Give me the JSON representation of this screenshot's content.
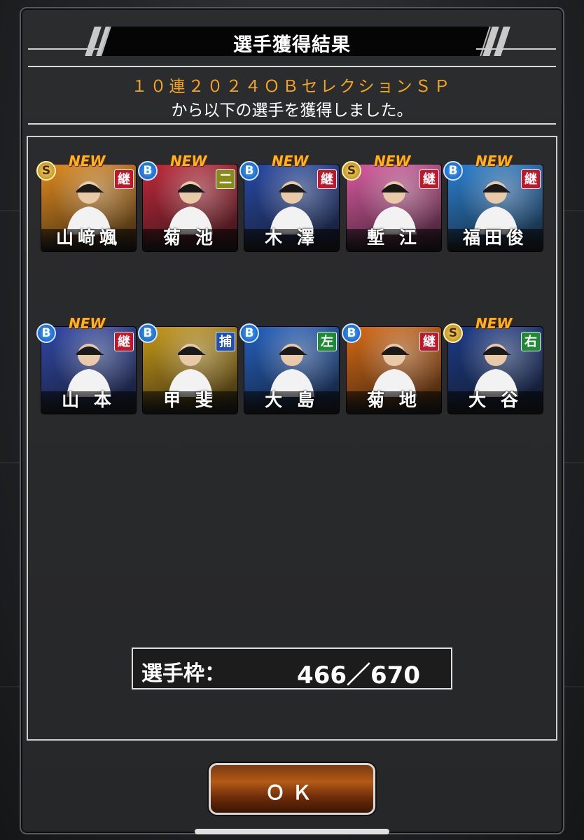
{
  "header": {
    "title": "選手獲得結果",
    "gacha_name": "１０連２０２４ＯＢセレクションＳＰ",
    "gacha_sub": "から以下の選手を獲得しました。"
  },
  "cards": [
    {
      "name": "山﨑颯",
      "rank": "S",
      "position": "継",
      "is_new": true,
      "new_label": "NEW",
      "bg": "#e08a1e",
      "pos_color": "#c0172a"
    },
    {
      "name": "菊 池",
      "rank": "B",
      "position": "二",
      "is_new": true,
      "new_label": "NEW",
      "bg": "#c0283a",
      "pos_color": "#8a8a18"
    },
    {
      "name": "木 澤",
      "rank": "B",
      "position": "継",
      "is_new": true,
      "new_label": "NEW",
      "bg": "#2849a6",
      "pos_color": "#c0172a"
    },
    {
      "name": "塹 江",
      "rank": "S",
      "position": "継",
      "is_new": true,
      "new_label": "NEW",
      "bg": "#d95aa0",
      "pos_color": "#c0172a"
    },
    {
      "name": "福田俊",
      "rank": "B",
      "position": "継",
      "is_new": true,
      "new_label": "NEW",
      "bg": "#2a7fd0",
      "pos_color": "#c0172a"
    },
    {
      "name": "山 本",
      "rank": "B",
      "position": "継",
      "is_new": true,
      "new_label": "NEW",
      "bg": "#3048a8",
      "pos_color": "#c0172a"
    },
    {
      "name": "甲 斐",
      "rank": "B",
      "position": "捕",
      "is_new": false,
      "new_label": "",
      "bg": "#c89a18",
      "pos_color": "#1e4fb5"
    },
    {
      "name": "大 島",
      "rank": "B",
      "position": "左",
      "is_new": false,
      "new_label": "",
      "bg": "#2460c0",
      "pos_color": "#1f8a35"
    },
    {
      "name": "菊 地",
      "rank": "B",
      "position": "継",
      "is_new": false,
      "new_label": "",
      "bg": "#d86a14",
      "pos_color": "#c0172a"
    },
    {
      "name": "大 谷",
      "rank": "S",
      "position": "右",
      "is_new": true,
      "new_label": "NEW",
      "bg": "#1c3b88",
      "pos_color": "#1f8a35"
    }
  ],
  "roster": {
    "label": "選手枠：",
    "value": "466／670"
  },
  "ok_button": {
    "label": "ＯＫ"
  }
}
